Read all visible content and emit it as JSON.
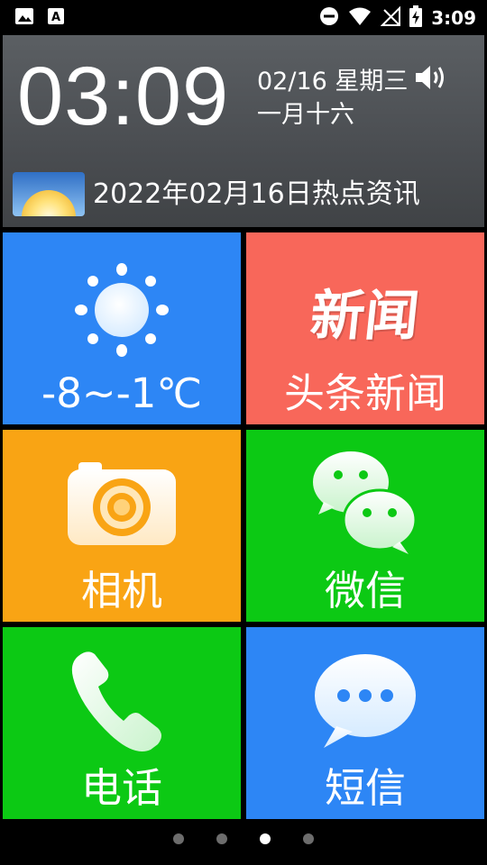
{
  "status_bar": {
    "time": "3:09",
    "icons_left": [
      "image-icon",
      "text-a-icon"
    ],
    "icons_right": [
      "do-not-disturb-icon",
      "wifi-icon",
      "no-signal-icon",
      "battery-charging-icon"
    ]
  },
  "header": {
    "clock": "03:09",
    "date": "02/16 星期三",
    "lunar_date": "一月十六",
    "news_headline": "2022年02月16日热点资讯"
  },
  "tiles": {
    "weather": {
      "label": "-8~-1℃",
      "color": "#2d86f5",
      "icon": "sun-icon"
    },
    "news": {
      "label": "头条新闻",
      "logo": "新闻",
      "color": "#f8675a"
    },
    "camera": {
      "label": "相机",
      "color": "#f9a414",
      "icon": "camera-icon"
    },
    "wechat": {
      "label": "微信",
      "color": "#0cc914",
      "icon": "wechat-icon"
    },
    "phone": {
      "label": "电话",
      "color": "#0cc914",
      "icon": "phone-icon"
    },
    "sms": {
      "label": "短信",
      "color": "#2d86f5",
      "icon": "message-bubble-icon"
    }
  },
  "pager": {
    "count": 4,
    "active_index": 2
  }
}
